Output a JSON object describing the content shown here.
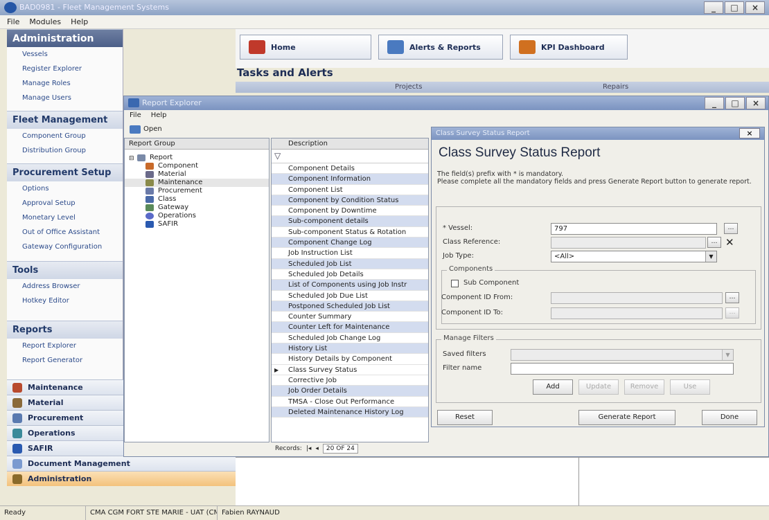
{
  "app": {
    "title": "BAD0981 - Fleet Management Systems"
  },
  "menubar": [
    "File",
    "Modules",
    "Help"
  ],
  "window_controls": [
    "_",
    "□",
    "×"
  ],
  "leftnav": {
    "admin_title": "Administration",
    "admin_items": [
      "Vessels",
      "Register Explorer",
      "Manage Roles",
      "Manage Users"
    ],
    "fleet_title": "Fleet Management",
    "fleet_items": [
      "Component Group",
      "Distribution Group"
    ],
    "proc_title": "Procurement Setup",
    "proc_items": [
      "Options",
      "Approval Setup",
      "Monetary Level",
      "Out of Office Assistant",
      "Gateway Configuration"
    ],
    "tools_title": "Tools",
    "tools_items": [
      "Address Browser",
      "Hotkey Editor"
    ],
    "reports_title": "Reports",
    "reports_items": [
      "Report Explorer",
      "Report Generator"
    ]
  },
  "modules": [
    {
      "label": "Maintenance",
      "color": "#b84a2e"
    },
    {
      "label": "Material",
      "color": "#8a6a3a"
    },
    {
      "label": "Procurement",
      "color": "#5a7ab0"
    },
    {
      "label": "Operations",
      "color": "#3a8a9a"
    },
    {
      "label": "SAFIR",
      "color": "#2a5ab0"
    },
    {
      "label": "Document Management",
      "color": "#7a9ad0"
    },
    {
      "label": "Administration",
      "color": "#8a6a2a"
    }
  ],
  "toolbar": {
    "home": "Home",
    "alerts": "Alerts & Reports",
    "kpi": "KPI Dashboard"
  },
  "tasks": {
    "title": "Tasks and Alerts",
    "tab_projects": "Projects",
    "tab_repairs": "Repairs"
  },
  "status": {
    "ready": "Ready",
    "vessel": "CMA CGM FORT STE MARIE - UAT (CMA",
    "user": "Fabien RAYNAUD"
  },
  "report_explorer": {
    "title": "Report Explorer",
    "menu": [
      "File",
      "Help"
    ],
    "open": "Open",
    "group_header": "Report Group",
    "root": "Report",
    "groups": [
      {
        "label": "Component",
        "color": "#c86a2a"
      },
      {
        "label": "Material",
        "color": "#6a6a8a"
      },
      {
        "label": "Maintenance",
        "color": "#8a8a4a"
      },
      {
        "label": "Procurement",
        "color": "#6a7aa8"
      },
      {
        "label": "Class",
        "color": "#4a6aa8"
      },
      {
        "label": "Gateway",
        "color": "#5a8a5a"
      },
      {
        "label": "Operations",
        "color": "#5a6ac8"
      },
      {
        "label": "SAFIR",
        "color": "#2a5ab0"
      }
    ],
    "desc_header": "Description",
    "descriptions": [
      "Component Details",
      "Component Information",
      "Component List",
      "Component by Condition Status",
      "Component by Downtime",
      "Sub-component details",
      "Sub-component Status & Rotation",
      "Component Change Log",
      "Job Instruction List",
      "Scheduled Job List",
      "Scheduled Job Details",
      "List of Components using Job Instr",
      "Scheduled Job Due List",
      "Postponed Scheduled Job List",
      "Counter Summary",
      "Counter Left for Maintenance",
      "Scheduled Job Change Log",
      "History List",
      "History Details by Component",
      "Class Survey Status",
      "Corrective Job",
      "Job Order Details",
      "TMSA - Close Out Performance",
      "Deleted Maintenance History Log"
    ],
    "records_label": "Records:",
    "records_value": "20 OF 24"
  },
  "dialog": {
    "title": "Class Survey Status Report",
    "heading": "Class Survey Status Report",
    "note1": "The field(s) prefix with * is mandatory.",
    "note2": "Please complete all the mandatory fields and press Generate Report button to generate report.",
    "vessel_label": "* Vessel:",
    "vessel_value": "797",
    "class_ref_label": "Class Reference:",
    "job_type_label": "Job Type:",
    "job_type_value": "<All>",
    "components_legend": "Components",
    "sub_component": "Sub Component",
    "comp_from_label": "Component ID From:",
    "comp_to_label": "Component ID To:",
    "filters_legend": "Manage Filters",
    "saved_filters_label": "Saved filters",
    "filter_name_label": "Filter name",
    "add": "Add",
    "update": "Update",
    "remove": "Remove",
    "use": "Use",
    "reset": "Reset",
    "generate": "Generate Report",
    "done": "Done"
  }
}
